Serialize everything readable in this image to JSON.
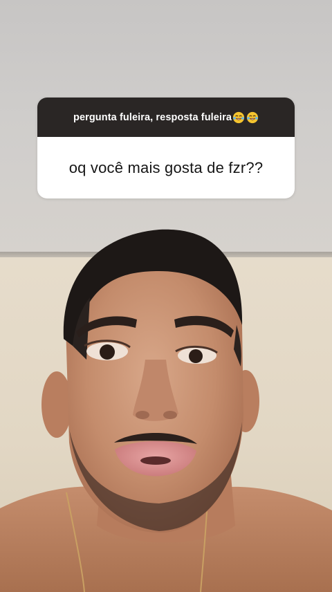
{
  "story": {
    "question_box": {
      "prompt": "pergunta fuleira, resposta fuleira",
      "prompt_emojis": [
        "laughing-with-tears-emoji",
        "laughing-with-tears-emoji"
      ],
      "question": "oq você mais gosta de fzr??"
    }
  },
  "colors": {
    "card_header_bg": "#2a2625",
    "card_body_bg": "#ffffff",
    "question_text": "#151515",
    "wall": "#e2d7c4",
    "ceiling": "#cfcdcb"
  }
}
